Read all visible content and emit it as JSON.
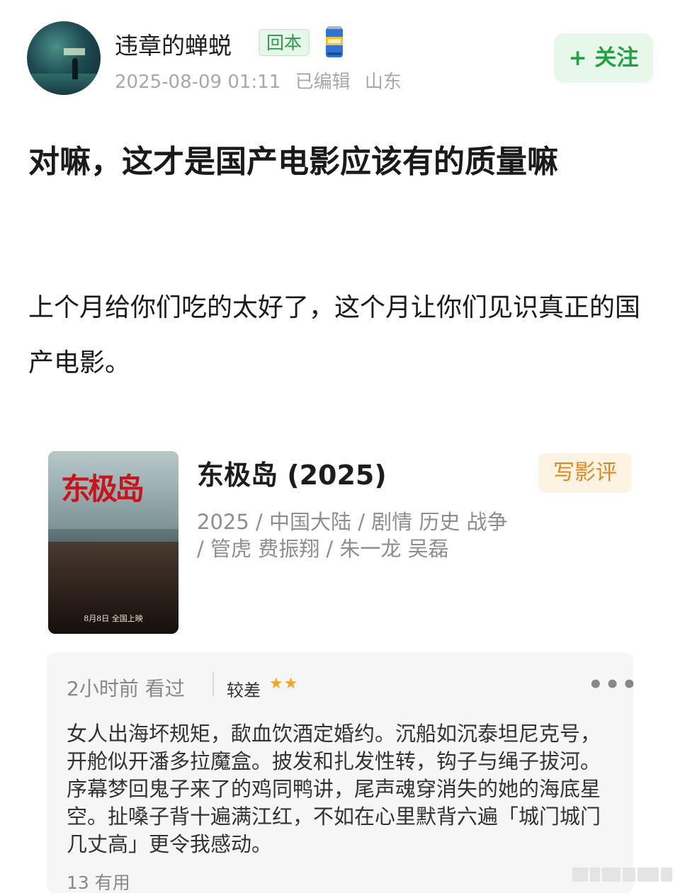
{
  "author": {
    "name": "违章的蝉蜕",
    "badge": "回本",
    "timestamp": "2025-08-09 01:11",
    "edited": "已编辑",
    "location": "山东"
  },
  "follow_button": {
    "label": "+ 关注"
  },
  "post": {
    "title": "对嘛，这才是国产电影应该有的质量嘛",
    "body": "上个月给你们吃的太好了，这个月让你们见识真正的国产电影。"
  },
  "movie": {
    "title": "东极岛 (2025)",
    "review_button": "写影评",
    "info": "2025 / 中国大陆 / 剧情 历史 战争 / 管虎 费振翔 / 朱一龙 吴磊",
    "poster_title": "东极岛",
    "poster_date": "8月8日 全国上映"
  },
  "comment": {
    "time": "2小时前 看过",
    "rating_label": "较差",
    "stars": "★★",
    "star_count": 2,
    "more": "•••",
    "text": "女人出海坏规矩，歃血饮酒定婚约。沉船如沉泰坦尼克号，开舱似开潘多拉魔盒。披发和扎发性转，钩子与绳子拔河。序幕梦回鬼子来了的鸡同鸭讲，尾声魂穿消失的她的海底星空。扯嗓子背十遍满江红，不如在心里默背六遍「城门城门几丈高」更令我感动。",
    "useful": "13 有用"
  },
  "colors": {
    "accent_green": "#25a145",
    "review_orange": "#e08a1e",
    "star_color": "#f5a623"
  }
}
